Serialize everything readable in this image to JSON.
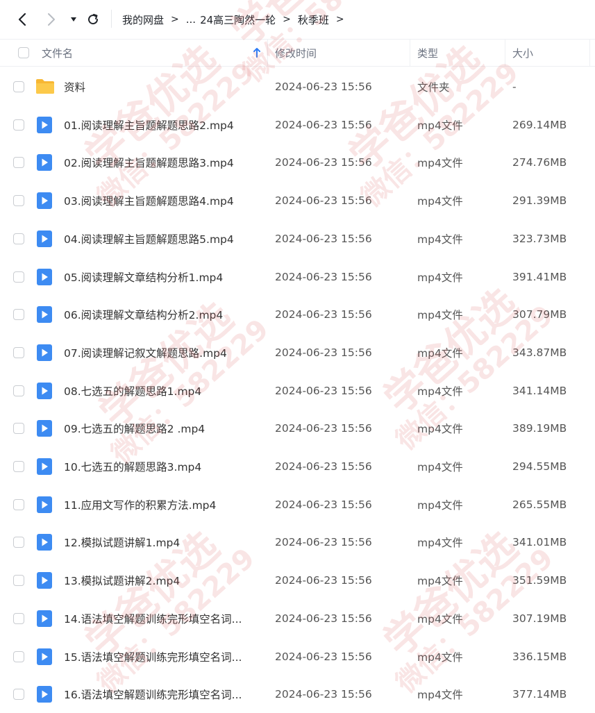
{
  "nav": {
    "back_icon": "chevron-left-icon",
    "forward_icon": "chevron-right-icon",
    "dropdown_icon": "caret-down-icon",
    "refresh_icon": "refresh-icon"
  },
  "breadcrumb": {
    "items": [
      "我的网盘",
      "...",
      "24高三陶然一轮",
      "秋季班"
    ],
    "separator": ">"
  },
  "columns": {
    "name": "文件名",
    "modified": "修改时间",
    "type": "类型",
    "size": "大小",
    "sort_icon": "sort-ascending-arrow-icon"
  },
  "files": [
    {
      "name": "资料",
      "modified": "2024-06-23 15:56",
      "type": "文件夹",
      "size": "-",
      "icon": "folder-icon"
    },
    {
      "name": "01.阅读理解主旨题解题思路2.mp4",
      "modified": "2024-06-23 15:56",
      "type": "mp4文件",
      "size": "269.14MB",
      "icon": "video-file-icon"
    },
    {
      "name": "02.阅读理解主旨题解题思路3.mp4",
      "modified": "2024-06-23 15:56",
      "type": "mp4文件",
      "size": "274.76MB",
      "icon": "video-file-icon"
    },
    {
      "name": "03.阅读理解主旨题解题思路4.mp4",
      "modified": "2024-06-23 15:56",
      "type": "mp4文件",
      "size": "291.39MB",
      "icon": "video-file-icon"
    },
    {
      "name": "04.阅读理解主旨题解题思路5.mp4",
      "modified": "2024-06-23 15:56",
      "type": "mp4文件",
      "size": "323.73MB",
      "icon": "video-file-icon"
    },
    {
      "name": "05.阅读理解文章结构分析1.mp4",
      "modified": "2024-06-23 15:56",
      "type": "mp4文件",
      "size": "391.41MB",
      "icon": "video-file-icon"
    },
    {
      "name": "06.阅读理解文章结构分析2.mp4",
      "modified": "2024-06-23 15:56",
      "type": "mp4文件",
      "size": "307.79MB",
      "icon": "video-file-icon"
    },
    {
      "name": "07.阅读理解记叙文解题思路.mp4",
      "modified": "2024-06-23 15:56",
      "type": "mp4文件",
      "size": "343.87MB",
      "icon": "video-file-icon"
    },
    {
      "name": "08.七选五的解题思路1.mp4",
      "modified": "2024-06-23 15:56",
      "type": "mp4文件",
      "size": "341.14MB",
      "icon": "video-file-icon"
    },
    {
      "name": "09.七选五的解题思路2 .mp4",
      "modified": "2024-06-23 15:56",
      "type": "mp4文件",
      "size": "389.19MB",
      "icon": "video-file-icon"
    },
    {
      "name": "10.七选五的解题思路3.mp4",
      "modified": "2024-06-23 15:56",
      "type": "mp4文件",
      "size": "294.55MB",
      "icon": "video-file-icon"
    },
    {
      "name": "11.应用文写作的积累方法.mp4",
      "modified": "2024-06-23 15:56",
      "type": "mp4文件",
      "size": "265.55MB",
      "icon": "video-file-icon"
    },
    {
      "name": "12.模拟试题讲解1.mp4",
      "modified": "2024-06-23 15:56",
      "type": "mp4文件",
      "size": "341.01MB",
      "icon": "video-file-icon"
    },
    {
      "name": "13.模拟试题讲解2.mp4",
      "modified": "2024-06-23 15:56",
      "type": "mp4文件",
      "size": "351.59MB",
      "icon": "video-file-icon"
    },
    {
      "name": "14.语法填空解题训练完形填空名词...",
      "modified": "2024-06-23 15:56",
      "type": "mp4文件",
      "size": "307.19MB",
      "icon": "video-file-icon"
    },
    {
      "name": "15.语法填空解题训练完形填空名词...",
      "modified": "2024-06-23 15:56",
      "type": "mp4文件",
      "size": "336.15MB",
      "icon": "video-file-icon"
    },
    {
      "name": "16.语法填空解题训练完形填空名词...",
      "modified": "2024-06-23 15:56",
      "type": "mp4文件",
      "size": "377.14MB",
      "icon": "video-file-icon"
    }
  ],
  "watermark": {
    "line1": "学爸优选",
    "line2": "微信：582229"
  },
  "colors": {
    "video_icon": "#3d8bf2",
    "folder_icon": "#f7b733",
    "watermark": "#da5c5c"
  }
}
